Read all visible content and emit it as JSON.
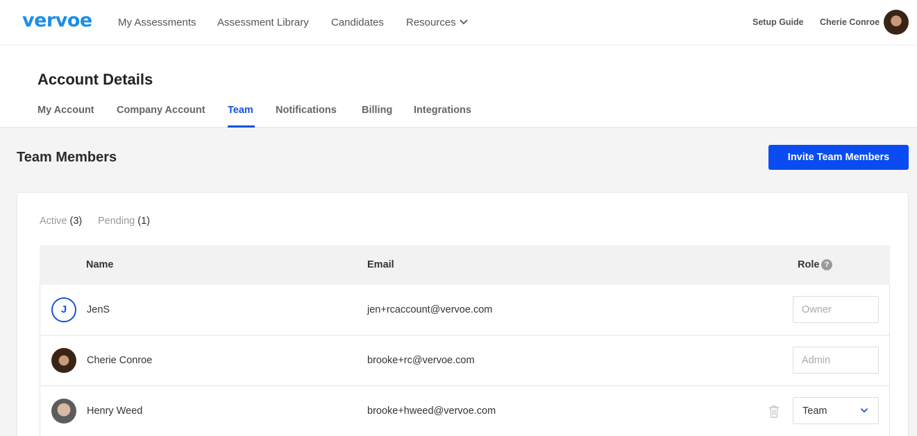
{
  "nav": {
    "logo": "vervoe",
    "links": [
      "My Assessments",
      "Assessment Library",
      "Candidates",
      "Resources"
    ],
    "setup_guide": "Setup Guide",
    "user_name": "Cherie Conroe",
    "icons": [
      "chevron-down-icon",
      "user-avatar"
    ]
  },
  "header": {
    "title": "Account Details",
    "tabs": [
      "My Account",
      "Company Account",
      "Team",
      "Notifications",
      "Billing",
      "Integrations"
    ],
    "active_tab": "Team"
  },
  "section": {
    "title": "Team Members",
    "invite_label": "Invite Team Members",
    "accent_color": "#0a4cf2"
  },
  "filters": {
    "active_label": "Active",
    "active_count": "(3)",
    "pending_label": "Pending",
    "pending_count": "(1)"
  },
  "table": {
    "columns": [
      "Name",
      "Email",
      "Role"
    ],
    "rows": [
      {
        "avatar": "J",
        "name": "JenS",
        "email": "jen+rcaccount@vervoe.com",
        "role": "Owner"
      },
      {
        "avatar": "photo",
        "name": "Cherie Conroe",
        "email": "brooke+rc@vervoe.com",
        "role": "Admin"
      },
      {
        "avatar": "photo",
        "name": "Henry Weed",
        "email": "brooke+hweed@vervoe.com",
        "role": "Team"
      }
    ]
  }
}
